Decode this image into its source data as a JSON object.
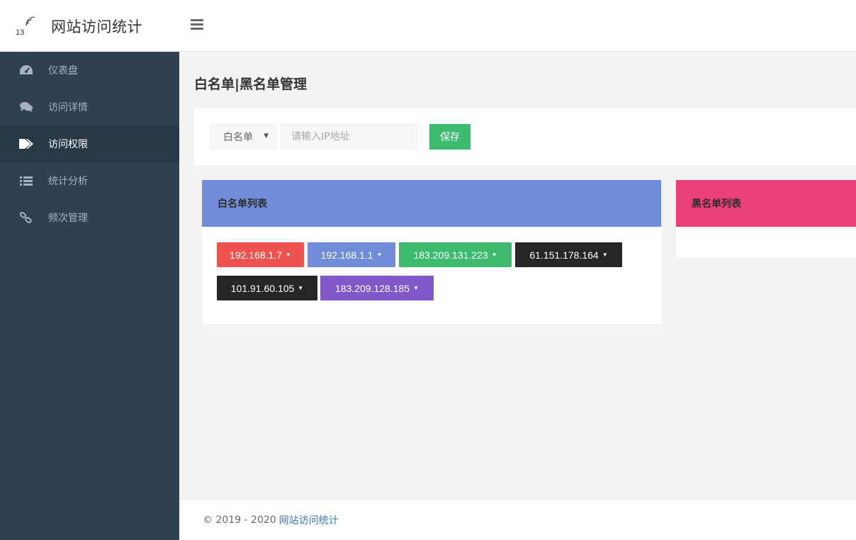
{
  "brand": {
    "logo_number": "13",
    "title": "网站访问统计"
  },
  "nav": [
    {
      "label": "仪表盘",
      "icon": "dashboard-icon",
      "active": false
    },
    {
      "label": "访问详情",
      "icon": "comments-icon",
      "active": false
    },
    {
      "label": "访问权限",
      "icon": "tags-icon",
      "active": true
    },
    {
      "label": "统计分析",
      "icon": "list-icon",
      "active": false
    },
    {
      "label": "频次管理",
      "icon": "link-icon",
      "active": false
    }
  ],
  "page": {
    "title": "白名单|黑名单管理"
  },
  "form": {
    "list_type": "白名单",
    "ip_placeholder": "请输入IP地址",
    "save_label": "保存"
  },
  "whitelist": {
    "title": "白名单列表",
    "ips": [
      {
        "ip": "192.168.1.7",
        "color": "#ef5350"
      },
      {
        "ip": "192.168.1.1",
        "color": "#6f8dd9"
      },
      {
        "ip": "183.209.131.223",
        "color": "#3cba6e"
      },
      {
        "ip": "61.151.178.164",
        "color": "#262626"
      },
      {
        "ip": "101.91.60.105",
        "color": "#262626"
      },
      {
        "ip": "183.209.128.185",
        "color": "#8058c8"
      }
    ]
  },
  "blacklist": {
    "title": "黑名单列表",
    "ips": []
  },
  "footer": {
    "copyright": "© 2019 - 2020",
    "link": "网站访问统计"
  },
  "colors": {
    "sidebar": "#2f4050",
    "sidebar_active": "#293846",
    "accent_green": "#3cba6e",
    "whitelist_header": "#6f8dd9",
    "blacklist_header": "#ec407a"
  }
}
